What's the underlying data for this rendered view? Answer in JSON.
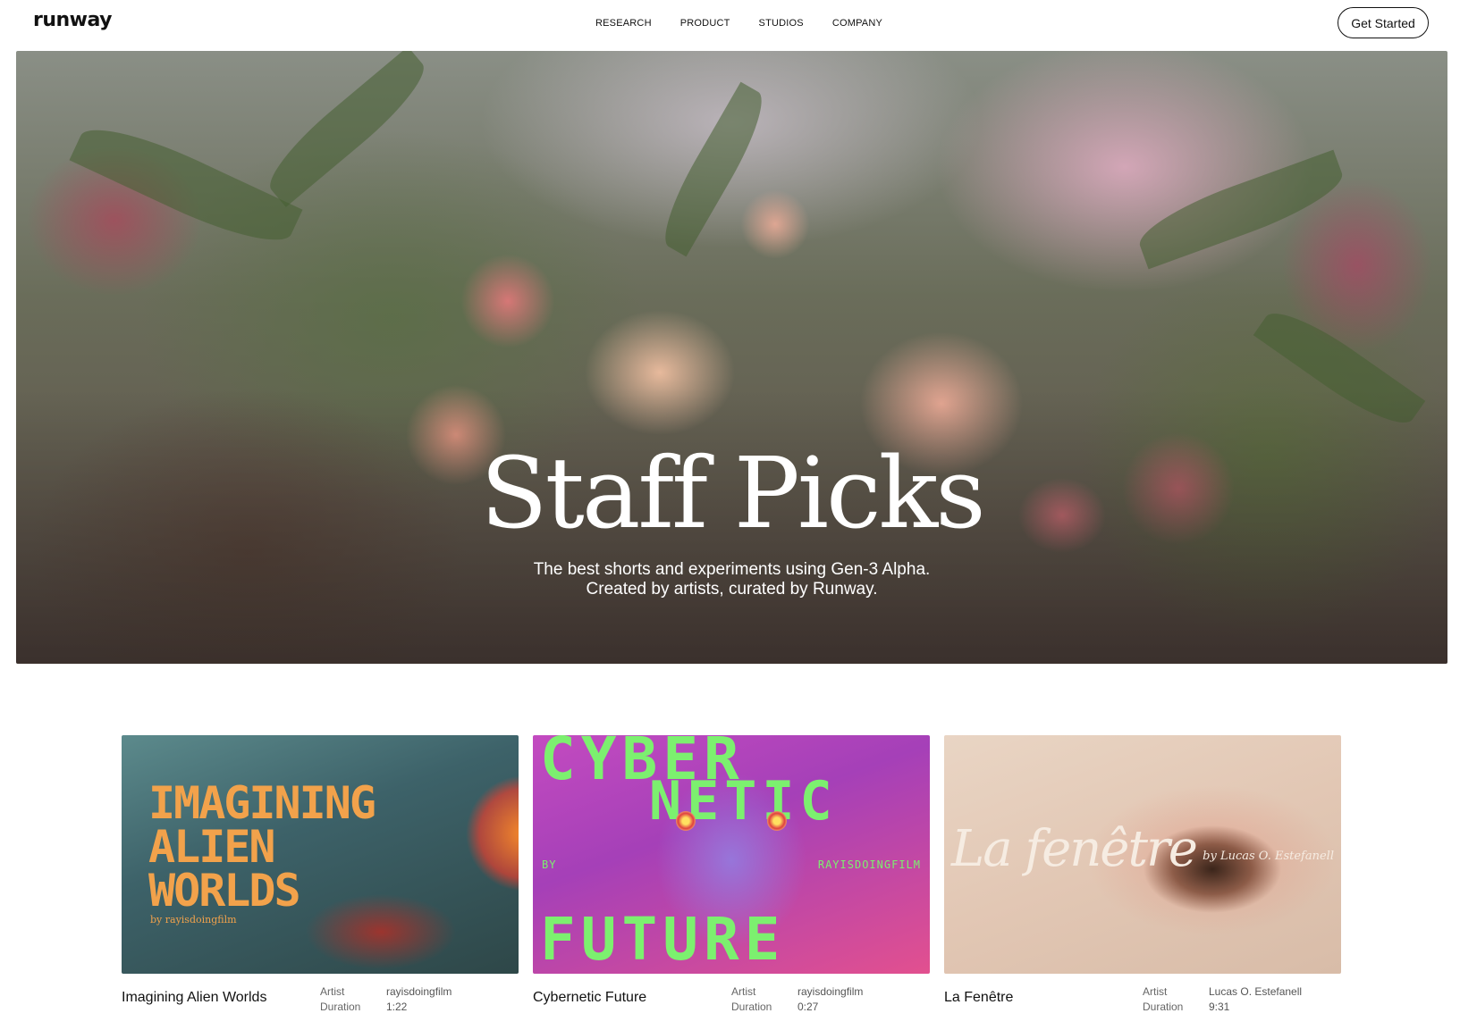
{
  "header": {
    "logo": "runway",
    "nav": [
      "RESEARCH",
      "PRODUCT",
      "STUDIOS",
      "COMPANY"
    ],
    "cta": "Get Started"
  },
  "hero": {
    "title": "Staff Picks",
    "subtitle_line1": "The best shorts and experiments using Gen-3 Alpha.",
    "subtitle_line2": "Created by artists, curated by Runway."
  },
  "cards": [
    {
      "title": "Imagining Alien Worlds",
      "artist_label": "Artist",
      "artist": "rayisdoingfilm",
      "duration_label": "Duration",
      "duration": "1:22",
      "thumb_text": "IMAGINING\nALIEN\nWORLDS",
      "thumb_by": "by rayisdoingfilm"
    },
    {
      "title": "Cybernetic Future",
      "artist_label": "Artist",
      "artist": "rayisdoingfilm",
      "duration_label": "Duration",
      "duration": "0:27",
      "thumb_line1": "CYBER",
      "thumb_line2": "NETIC",
      "thumb_line3": "FUTURE",
      "thumb_by_left": "BY",
      "thumb_by_right": "RAYISDOINGFILM"
    },
    {
      "title": "La Fenêtre",
      "artist_label": "Artist",
      "artist": "Lucas O. Estefanell",
      "duration_label": "Duration",
      "duration": "9:31",
      "thumb_title": "La fenêtre",
      "thumb_by": "by Lucas O. Estefanell"
    }
  ]
}
